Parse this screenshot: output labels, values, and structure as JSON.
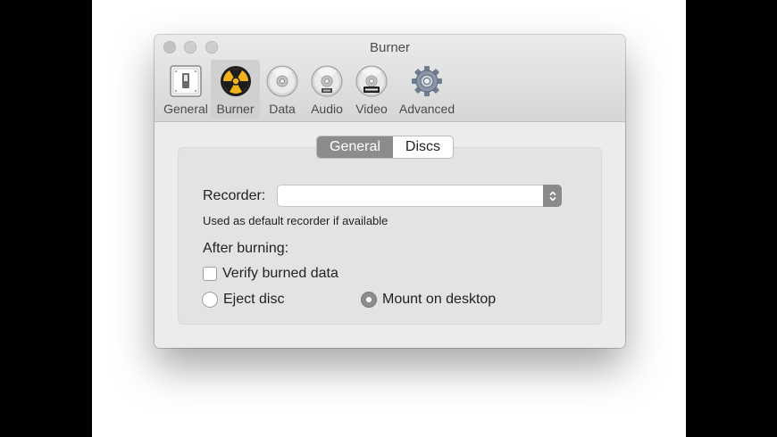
{
  "window": {
    "title": "Burner"
  },
  "toolbar": {
    "items": [
      {
        "label": "General",
        "icon": "switch-icon"
      },
      {
        "label": "Burner",
        "icon": "radiation-icon",
        "selected": true
      },
      {
        "label": "Data",
        "icon": "cd-icon"
      },
      {
        "label": "Audio",
        "icon": "audio-cd-icon"
      },
      {
        "label": "Video",
        "icon": "dvd-icon"
      },
      {
        "label": "Advanced",
        "icon": "gear-icon"
      }
    ]
  },
  "tabs": [
    {
      "label": "General",
      "active": true
    },
    {
      "label": "Discs",
      "active": false
    }
  ],
  "form": {
    "recorder_label": "Recorder:",
    "recorder_value": "",
    "recorder_hint": "Used as default recorder if available",
    "after_burning_label": "After burning:",
    "verify_label": "Verify burned data",
    "verify_checked": false,
    "eject_label": "Eject disc",
    "mount_label": "Mount on desktop",
    "selected_option": "Mount on desktop"
  }
}
